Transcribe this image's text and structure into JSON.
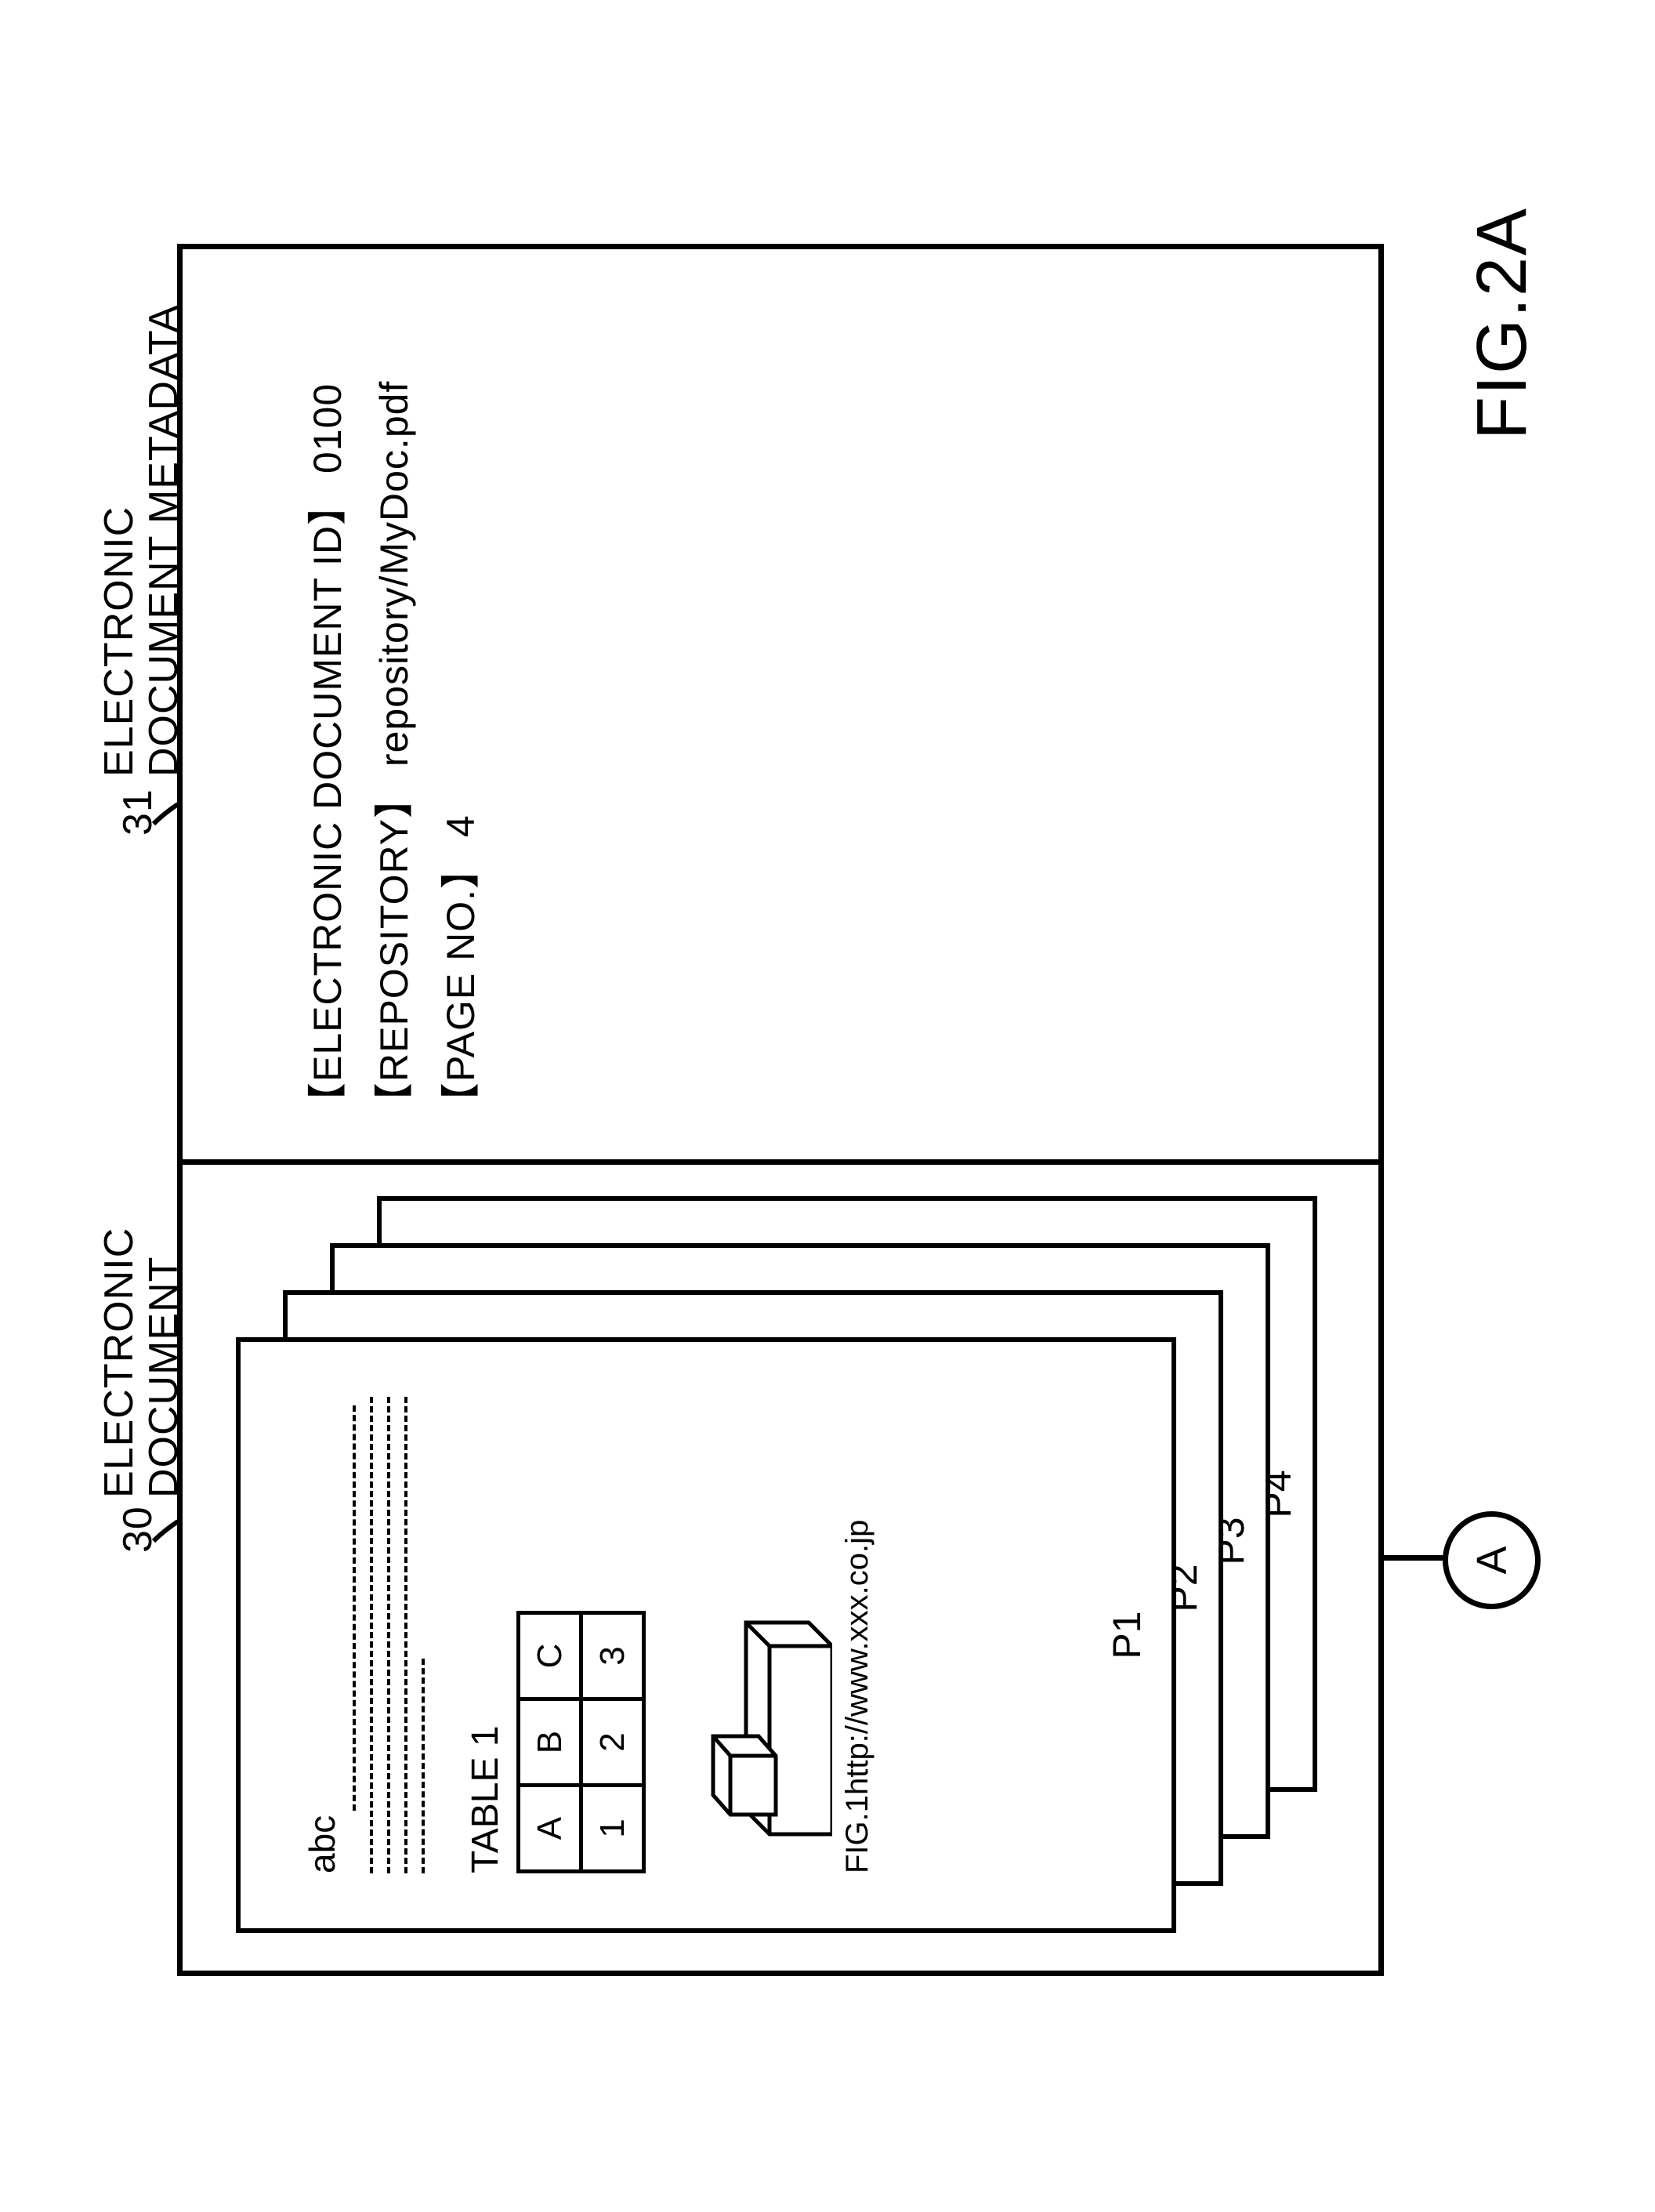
{
  "labels": {
    "left_num": "30",
    "left_text_l1": "ELECTRONIC",
    "left_text_l2": "DOCUMENT",
    "right_num": "31",
    "right_text_l1": "ELECTRONIC",
    "right_text_l2": "DOCUMENT METADATA"
  },
  "page1": {
    "abc": "abc",
    "table_title": "TABLE 1",
    "table_rows": [
      [
        "A",
        "B",
        "C"
      ],
      [
        "1",
        "2",
        "3"
      ]
    ],
    "fig_caption": "FIG.1http://www.xxx.co.jp",
    "page_label": "P1"
  },
  "page_labels": {
    "p2": "P2",
    "p3": "P3",
    "p4": "P4"
  },
  "metadata": {
    "row1_key": "【ELECTRONIC DOCUMENT ID】",
    "row1_val": "0100",
    "row2_key": "【REPOSITORY】",
    "row2_val": "repository/MyDoc.pdf",
    "row3_key": "【PAGE NO.】",
    "row3_val": "4"
  },
  "connector": "A",
  "figure_main": "FIG.2A"
}
